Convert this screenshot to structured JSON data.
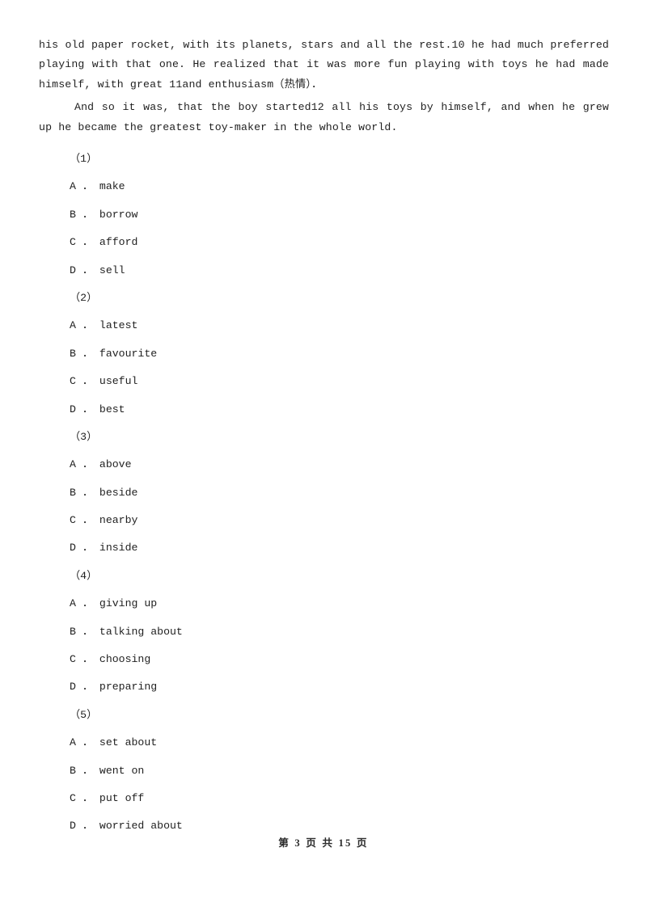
{
  "document": {
    "passage_paragraphs": [
      {
        "id": "para-1",
        "indent": false,
        "text": "his old paper rocket, with its planets, stars and all the rest.10 he had much preferred playing with that one. He realized that it was more fun playing with toys he had made himself, with great 11and enthusiasm（热情）．"
      },
      {
        "id": "para-2",
        "indent": true,
        "text": "And so it was, that the boy started12 all his toys by himself, and when he grew up he became the greatest toy-maker in the whole world."
      }
    ],
    "questions": [
      {
        "number": "（1）",
        "options": [
          "A ． make",
          "B ． borrow",
          "C ． afford",
          "D ． sell"
        ]
      },
      {
        "number": "（2）",
        "options": [
          "A ． latest",
          "B ． favourite",
          "C ． useful",
          "D ． best"
        ]
      },
      {
        "number": "（3）",
        "options": [
          "A ． above",
          "B ． beside",
          "C ． nearby",
          "D ． inside"
        ]
      },
      {
        "number": "（4）",
        "options": [
          "A ． giving up",
          "B ． talking about",
          "C ． choosing",
          "D ． preparing"
        ]
      },
      {
        "number": "（5）",
        "options": [
          "A ． set about",
          "B ． went on",
          "C ． put off",
          "D ． worried about"
        ]
      }
    ],
    "footer": {
      "page_text": "第 3 页 共 15 页",
      "current_page": "3",
      "total_pages": "15"
    },
    "colors": {
      "background": "#ffffff",
      "text": "#1f1f1f",
      "footer_text": "#2b2b2b"
    }
  }
}
